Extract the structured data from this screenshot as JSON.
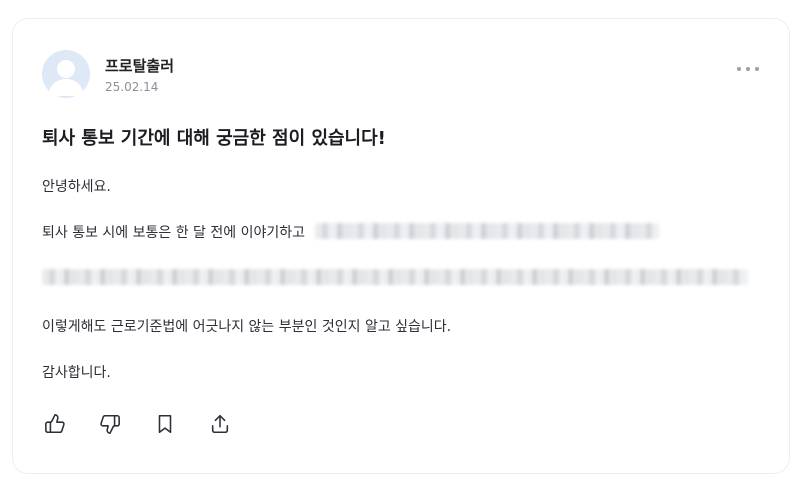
{
  "post": {
    "author": "프로탈출러",
    "date": "25.02.14",
    "title": "퇴사 통보 기간에 대해 궁금한 점이 있습니다!",
    "greeting": "안녕하세요.",
    "line2_visible": "퇴사 통보 시에 보통은 한 달 전에 이야기하고",
    "line4": "이렇게해도 근로기준법에 어긋나지 않는 부분인 것인지 알고 싶습니다.",
    "closing": "감사합니다."
  },
  "icons": {
    "more": "more-horizontal-icon",
    "like": "thumbs-up-icon",
    "dislike": "thumbs-down-icon",
    "bookmark": "bookmark-icon",
    "share": "share-icon"
  },
  "colors": {
    "avatar_bg": "#dfe8f6",
    "text": "#2b2f36",
    "muted": "#8b9098",
    "border": "#eceef1"
  }
}
